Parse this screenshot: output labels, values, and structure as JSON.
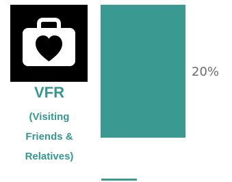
{
  "category_icon": "medical-bag-heart-icon",
  "category": {
    "title": "VFR",
    "subtitle": "(Visiting Friends & Relatives)",
    "subtitle_lines": [
      "(Visiting",
      "Friends &",
      "Relatives)"
    ]
  },
  "colors": {
    "accent_text": "#35978f",
    "bar": "#3a9a91",
    "icon_bg": "#000000",
    "icon_fg": "#ffffff",
    "label_text": "#6b6b6b"
  },
  "chart_data": {
    "type": "bar",
    "orientation": "vertical",
    "categories": [
      "VFR (Visiting Friends & Relatives)"
    ],
    "values": [
      20
    ],
    "value_labels": [
      "20%"
    ],
    "unit": "%",
    "baseline_marker": true,
    "title": "",
    "xlabel": "",
    "ylabel": "",
    "ylim": [
      0,
      20
    ]
  }
}
